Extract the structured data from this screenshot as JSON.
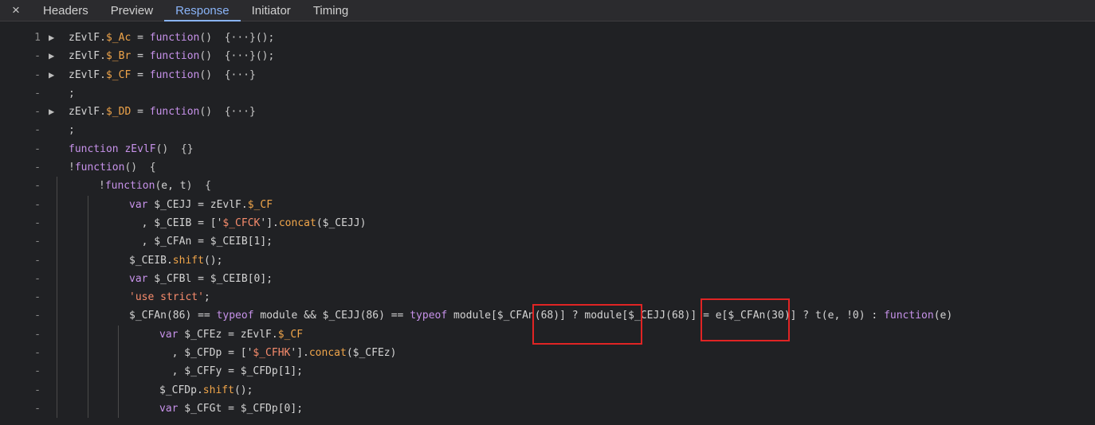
{
  "tabs": {
    "close_icon": "×",
    "items": [
      "Headers",
      "Preview",
      "Response",
      "Initiator",
      "Timing"
    ],
    "active": "Response"
  },
  "colors": {
    "accent": "#8ab4f8",
    "keyword": "#c792ea",
    "property": "#f0a54a",
    "string": "#f78c6c",
    "highlight": "#e02424"
  },
  "lines": [
    {
      "num": "1",
      "fold": "▶",
      "indent": 0,
      "tokens": [
        [
          "var",
          "zEvlF"
        ],
        [
          "punc",
          "."
        ],
        [
          "prop",
          "$_Ac"
        ],
        [
          "var",
          " = "
        ],
        [
          "kw",
          "function"
        ],
        [
          "punc",
          "()  {···}();"
        ]
      ]
    },
    {
      "num": "-",
      "fold": "▶",
      "indent": 0,
      "tokens": [
        [
          "var",
          "zEvlF"
        ],
        [
          "punc",
          "."
        ],
        [
          "prop",
          "$_Br"
        ],
        [
          "var",
          " = "
        ],
        [
          "kw",
          "function"
        ],
        [
          "punc",
          "()  {···}();"
        ]
      ]
    },
    {
      "num": "-",
      "fold": "▶",
      "indent": 0,
      "tokens": [
        [
          "var",
          "zEvlF"
        ],
        [
          "punc",
          "."
        ],
        [
          "prop",
          "$_CF"
        ],
        [
          "var",
          " = "
        ],
        [
          "kw",
          "function"
        ],
        [
          "punc",
          "()  {···}"
        ]
      ]
    },
    {
      "num": "-",
      "fold": "",
      "indent": 0,
      "tokens": [
        [
          "punc",
          ";"
        ]
      ]
    },
    {
      "num": "-",
      "fold": "▶",
      "indent": 0,
      "tokens": [
        [
          "var",
          "zEvlF"
        ],
        [
          "punc",
          "."
        ],
        [
          "prop",
          "$_DD"
        ],
        [
          "var",
          " = "
        ],
        [
          "kw",
          "function"
        ],
        [
          "punc",
          "()  {···}"
        ]
      ]
    },
    {
      "num": "-",
      "fold": "",
      "indent": 0,
      "tokens": [
        [
          "punc",
          ";"
        ]
      ]
    },
    {
      "num": "-",
      "fold": "",
      "indent": 0,
      "tokens": [
        [
          "kw",
          "function"
        ],
        [
          "var",
          " "
        ],
        [
          "kw",
          "zEvlF"
        ],
        [
          "punc",
          "()  {}"
        ]
      ]
    },
    {
      "num": "-",
      "fold": "",
      "indent": 0,
      "tokens": [
        [
          "punc",
          "!"
        ],
        [
          "kw",
          "function"
        ],
        [
          "punc",
          "()  {"
        ]
      ]
    },
    {
      "num": "-",
      "fold": "",
      "indent": 1,
      "tokens": [
        [
          "punc",
          "!"
        ],
        [
          "kw",
          "function"
        ],
        [
          "punc",
          "("
        ],
        [
          "var",
          "e, t"
        ],
        [
          "punc",
          ")  {"
        ]
      ]
    },
    {
      "num": "-",
      "fold": "",
      "indent": 2,
      "tokens": [
        [
          "kw",
          "var"
        ],
        [
          "var",
          " $_CEJJ = zEvlF."
        ],
        [
          "prop",
          "$_CF"
        ]
      ]
    },
    {
      "num": "-",
      "fold": "",
      "indent": 2,
      "tokens": [
        [
          "var",
          "  , $_CEIB = ['"
        ],
        [
          "str",
          "$_CFCK"
        ],
        [
          "var",
          "']."
        ],
        [
          "prop",
          "concat"
        ],
        [
          "var",
          "($_CEJJ)"
        ]
      ]
    },
    {
      "num": "-",
      "fold": "",
      "indent": 2,
      "tokens": [
        [
          "var",
          "  , $_CFAn = $_CEIB[1];"
        ]
      ]
    },
    {
      "num": "-",
      "fold": "",
      "indent": 2,
      "tokens": [
        [
          "var",
          "$_CEIB."
        ],
        [
          "prop",
          "shift"
        ],
        [
          "var",
          "();"
        ]
      ]
    },
    {
      "num": "-",
      "fold": "",
      "indent": 2,
      "tokens": [
        [
          "kw",
          "var"
        ],
        [
          "var",
          " $_CFBl = $_CEIB[0];"
        ]
      ]
    },
    {
      "num": "-",
      "fold": "",
      "indent": 2,
      "tokens": [
        [
          "str",
          "'use strict'"
        ],
        [
          "var",
          ";"
        ]
      ]
    },
    {
      "num": "-",
      "fold": "",
      "indent": 2,
      "tokens": [
        [
          "var",
          "$_CFAn(86) == "
        ],
        [
          "kw",
          "typeof"
        ],
        [
          "var",
          " module && $_CEJJ(86) == "
        ],
        [
          "kw",
          "typeof"
        ],
        [
          "var",
          " module[$_CFAn(68)] ? module[$_CEJJ(68)] = e[$_CFAn(30)] ? t(e, !0) : "
        ],
        [
          "kw",
          "function"
        ],
        [
          "var",
          "(e)"
        ]
      ]
    },
    {
      "num": "-",
      "fold": "",
      "indent": 3,
      "tokens": [
        [
          "kw",
          "var"
        ],
        [
          "var",
          " $_CFEz = zEvlF."
        ],
        [
          "prop",
          "$_CF"
        ]
      ]
    },
    {
      "num": "-",
      "fold": "",
      "indent": 3,
      "tokens": [
        [
          "var",
          "  , $_CFDp = ['"
        ],
        [
          "str",
          "$_CFHK"
        ],
        [
          "var",
          "']."
        ],
        [
          "prop",
          "concat"
        ],
        [
          "var",
          "($_CFEz)"
        ]
      ]
    },
    {
      "num": "-",
      "fold": "",
      "indent": 3,
      "tokens": [
        [
          "var",
          "  , $_CFFy = $_CFDp[1];"
        ]
      ]
    },
    {
      "num": "-",
      "fold": "",
      "indent": 3,
      "tokens": [
        [
          "var",
          "$_CFDp."
        ],
        [
          "prop",
          "shift"
        ],
        [
          "var",
          "();"
        ]
      ]
    },
    {
      "num": "-",
      "fold": "",
      "indent": 3,
      "tokens": [
        [
          "kw",
          "var"
        ],
        [
          "var",
          " $_CFGt = $_CFDp[0];"
        ]
      ]
    }
  ]
}
